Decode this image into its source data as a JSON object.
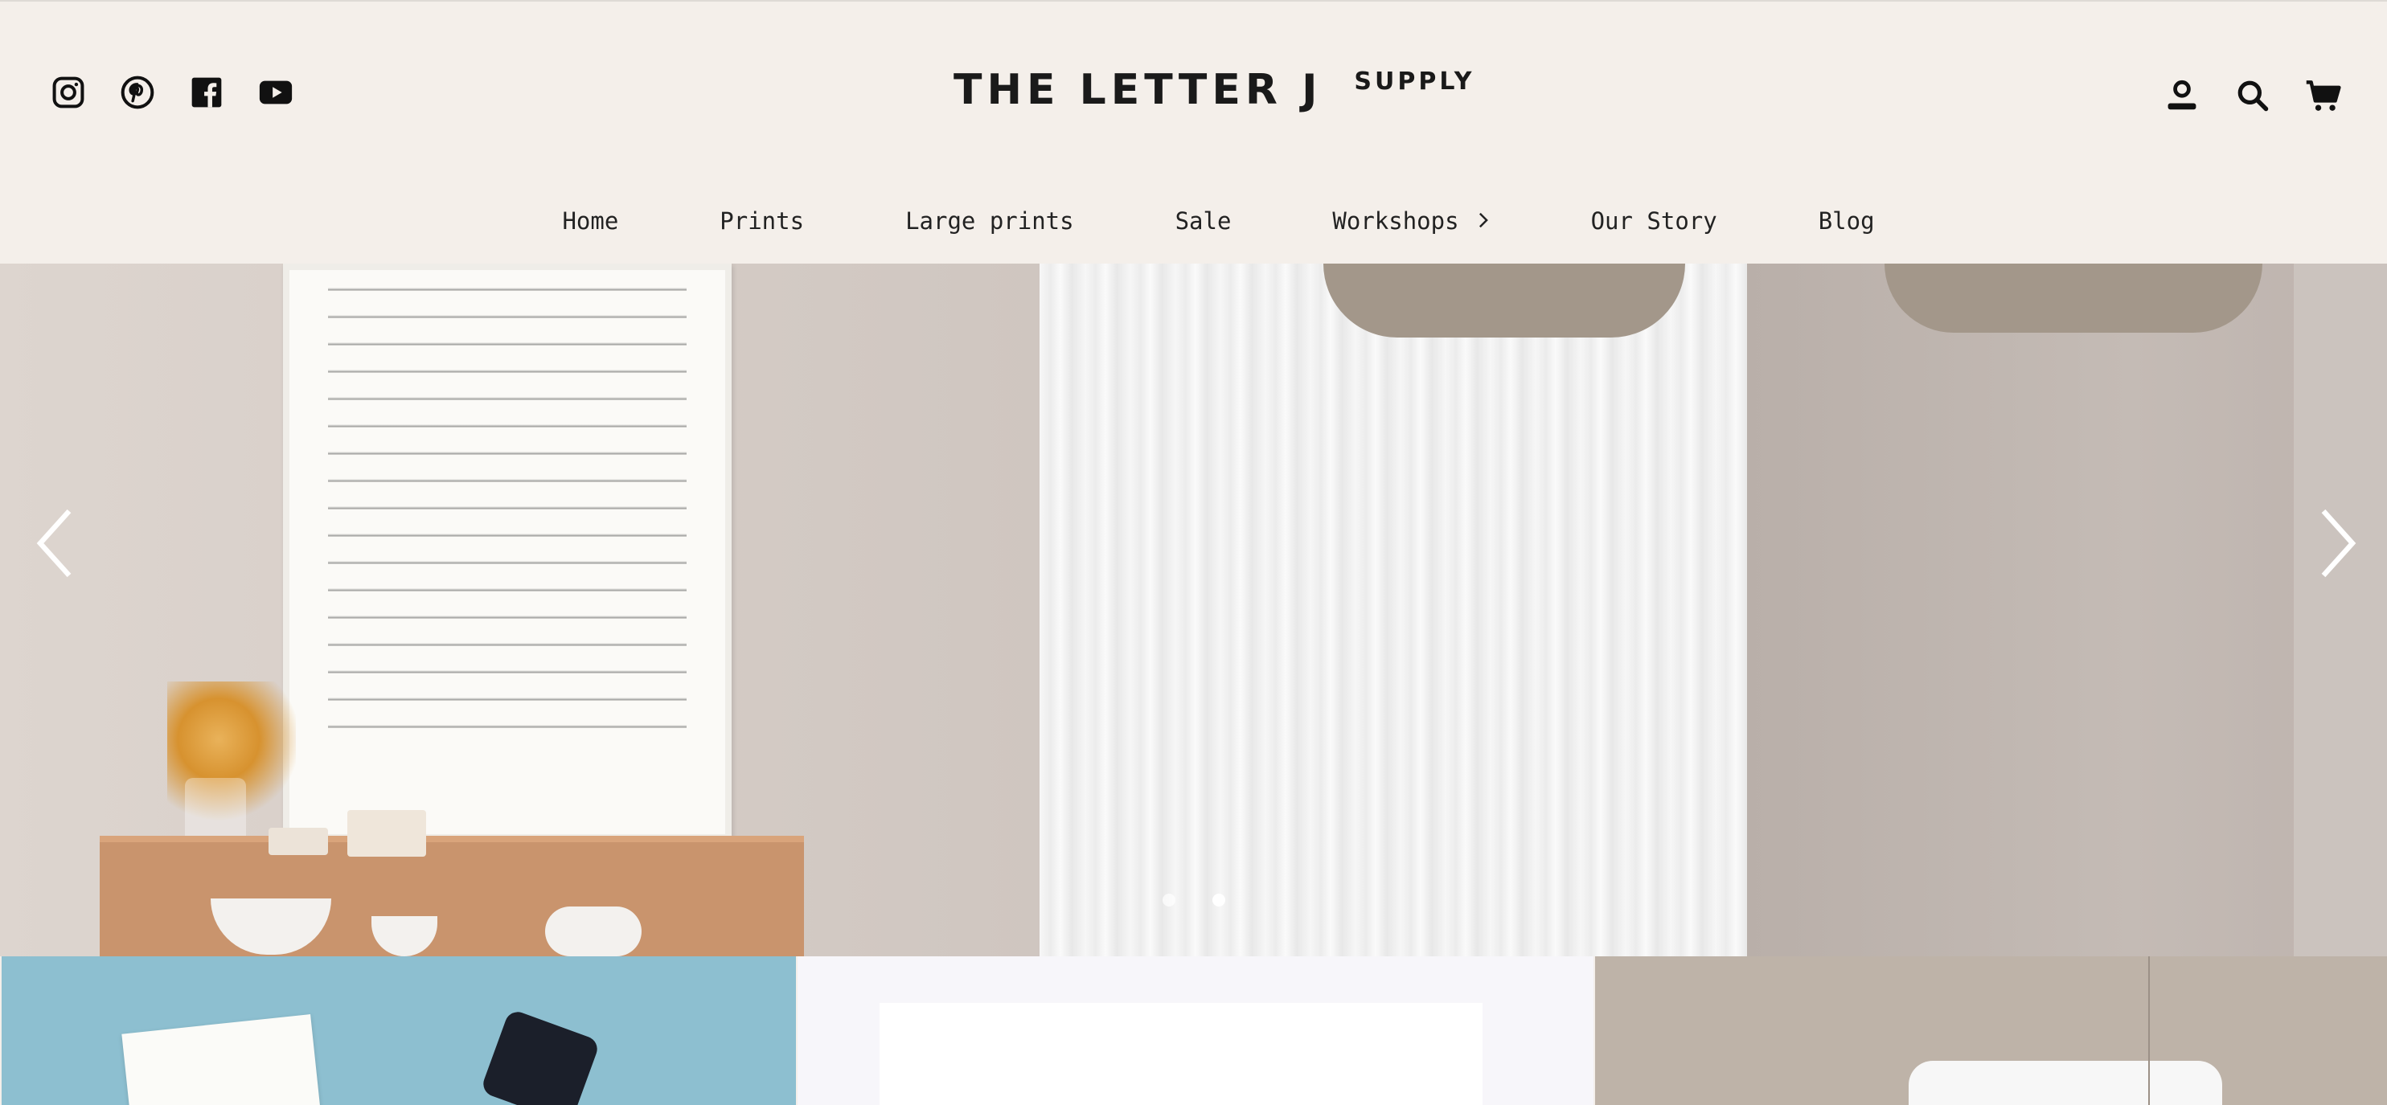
{
  "header": {
    "logo_main": "THE LETTER J",
    "logo_sub": "SUPPLY",
    "social_icons": [
      "instagram-icon",
      "pinterest-icon",
      "facebook-icon",
      "youtube-icon"
    ],
    "tool_icons": [
      "account-icon",
      "search-icon",
      "cart-icon"
    ]
  },
  "nav": {
    "items": [
      {
        "label": "Home"
      },
      {
        "label": "Prints"
      },
      {
        "label": "Large prints"
      },
      {
        "label": "Sale"
      },
      {
        "label": "Workshops"
      },
      {
        "label": "Our Story"
      },
      {
        "label": "Blog"
      }
    ]
  },
  "hero": {
    "prev_icon": "chevron-left-icon",
    "next_icon": "chevron-right-icon",
    "slide_count": 2,
    "active_slide": 2
  },
  "colors": {
    "header_bg": "#f4efea",
    "text": "#1a1a1a",
    "tile1_bg": "#8dbfd0",
    "tile2_bg": "#f7f6fa",
    "tile3_bg": "#beb3a8"
  }
}
